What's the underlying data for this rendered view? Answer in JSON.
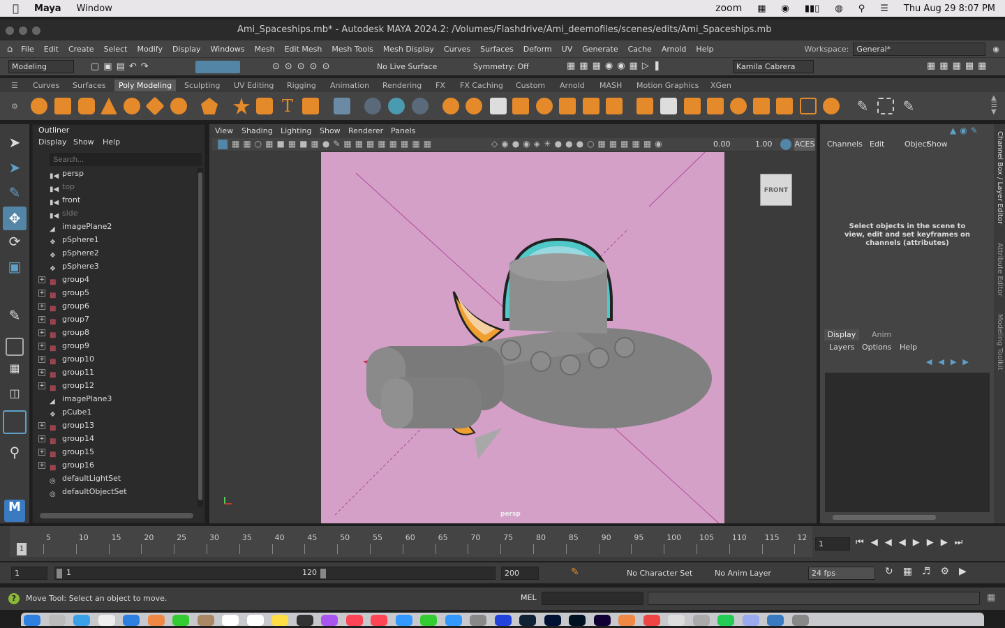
{
  "macos": {
    "app": "Maya",
    "menu": "Window",
    "zoom": "zoom",
    "clock": "Thu Aug 29  8:07 PM"
  },
  "window": {
    "title": "Ami_Spaceships.mb* - Autodesk MAYA 2024.2: /Volumes/Flashdrive/Ami_deemofiles/scenes/edits/Ami_Spaceships.mb"
  },
  "menubar": {
    "items": [
      "File",
      "Edit",
      "Create",
      "Select",
      "Modify",
      "Display",
      "Windows",
      "Mesh",
      "Edit Mesh",
      "Mesh Tools",
      "Mesh Display",
      "Curves",
      "Surfaces",
      "Deform",
      "UV",
      "Generate",
      "Cache",
      "Arnold",
      "Help"
    ],
    "workspace_label": "Workspace:",
    "workspace_value": "General*"
  },
  "statusline": {
    "mode": "Modeling",
    "live_surface": "No Live Surface",
    "symmetry": "Symmetry: Off",
    "user": "Kamila Cabrera"
  },
  "shelf": {
    "tabs": [
      "Curves",
      "Surfaces",
      "Poly Modeling",
      "Sculpting",
      "UV Editing",
      "Rigging",
      "Animation",
      "Rendering",
      "FX",
      "FX Caching",
      "Custom",
      "Arnold",
      "MASH",
      "Motion Graphics",
      "XGen"
    ],
    "active_tab": "Poly Modeling"
  },
  "outliner": {
    "title": "Outliner",
    "menus": [
      "Display",
      "Show",
      "Help"
    ],
    "search_placeholder": "Search...",
    "items": [
      {
        "name": "persp",
        "type": "camera",
        "dim": false,
        "expand": false
      },
      {
        "name": "top",
        "type": "camera",
        "dim": true,
        "expand": false
      },
      {
        "name": "front",
        "type": "camera",
        "dim": false,
        "expand": false
      },
      {
        "name": "side",
        "type": "camera",
        "dim": true,
        "expand": false
      },
      {
        "name": "imagePlane2",
        "type": "imageplane",
        "dim": false,
        "expand": false
      },
      {
        "name": "pSphere1",
        "type": "mesh",
        "dim": false,
        "expand": false
      },
      {
        "name": "pSphere2",
        "type": "mesh",
        "dim": false,
        "expand": false
      },
      {
        "name": "pSphere3",
        "type": "mesh",
        "dim": false,
        "expand": false
      },
      {
        "name": "group4",
        "type": "group",
        "dim": false,
        "expand": true
      },
      {
        "name": "group5",
        "type": "group",
        "dim": false,
        "expand": true
      },
      {
        "name": "group6",
        "type": "group",
        "dim": false,
        "expand": true
      },
      {
        "name": "group7",
        "type": "group",
        "dim": false,
        "expand": true
      },
      {
        "name": "group8",
        "type": "group",
        "dim": false,
        "expand": true
      },
      {
        "name": "group9",
        "type": "group",
        "dim": false,
        "expand": true
      },
      {
        "name": "group10",
        "type": "group",
        "dim": false,
        "expand": true
      },
      {
        "name": "group11",
        "type": "group",
        "dim": false,
        "expand": true
      },
      {
        "name": "group12",
        "type": "group",
        "dim": false,
        "expand": true
      },
      {
        "name": "imagePlane3",
        "type": "imageplane",
        "dim": false,
        "expand": false
      },
      {
        "name": "pCube1",
        "type": "mesh",
        "dim": false,
        "expand": false
      },
      {
        "name": "group13",
        "type": "group",
        "dim": false,
        "expand": true
      },
      {
        "name": "group14",
        "type": "group",
        "dim": false,
        "expand": true
      },
      {
        "name": "group15",
        "type": "group",
        "dim": false,
        "expand": true
      },
      {
        "name": "group16",
        "type": "group",
        "dim": false,
        "expand": true
      },
      {
        "name": "defaultLightSet",
        "type": "set",
        "dim": false,
        "expand": false
      },
      {
        "name": "defaultObjectSet",
        "type": "set",
        "dim": false,
        "expand": false
      }
    ]
  },
  "viewport": {
    "menus": [
      "View",
      "Shading",
      "Lighting",
      "Show",
      "Renderer",
      "Panels"
    ],
    "value_a": "0.00",
    "value_b": "1.00",
    "colorspace": "ACES",
    "camera_label": "persp",
    "cube_label": "FRONT"
  },
  "channelbox": {
    "menus": [
      "Channels",
      "Edit",
      "Object",
      "Show"
    ],
    "message": "Select objects in the scene to view, edit and set keyframes on channels (attributes)",
    "layer_tabs": [
      "Display",
      "Anim"
    ],
    "layer_menus": [
      "Layers",
      "Options",
      "Help"
    ],
    "side_tabs": [
      "Channel Box / Layer Editor",
      "Attribute Editor",
      "Modeling Toolkit"
    ]
  },
  "timeline": {
    "ticks": [
      "5",
      "10",
      "15",
      "20",
      "25",
      "30",
      "35",
      "40",
      "45",
      "50",
      "55",
      "60",
      "65",
      "70",
      "75",
      "80",
      "85",
      "90",
      "95",
      "100",
      "105",
      "110",
      "115",
      "12"
    ],
    "current_marker": "1",
    "current_frame": "1"
  },
  "range": {
    "start": "1",
    "inner_start": "1",
    "inner_end": "120",
    "end": "200",
    "character_set": "No Character Set",
    "anim_layer": "No Anim Layer",
    "fps": "24 fps"
  },
  "helpline": {
    "message": "Move Tool: Select an object to move.",
    "script_lang": "MEL"
  },
  "colors": {
    "accent": "#5285a6",
    "viewport_bg": "#d4a0c8",
    "shelf_orange": "#e58a2a"
  }
}
